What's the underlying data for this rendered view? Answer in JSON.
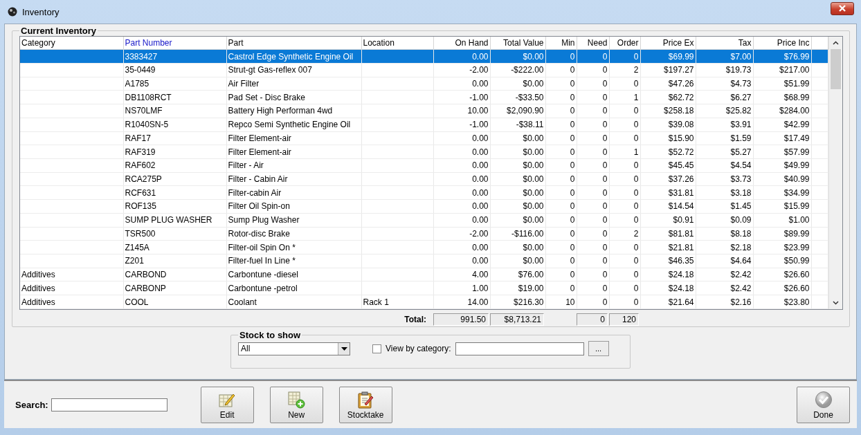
{
  "window": {
    "title": "Inventory"
  },
  "inventory": {
    "title": "Current Inventory",
    "columns": [
      {
        "label": "Category",
        "sorted": false
      },
      {
        "label": "Part Number",
        "sorted": true
      },
      {
        "label": "Part",
        "sorted": false
      },
      {
        "label": "Location",
        "sorted": false
      },
      {
        "label": "On Hand",
        "sorted": false
      },
      {
        "label": "Total Value",
        "sorted": false
      },
      {
        "label": "Min",
        "sorted": false
      },
      {
        "label": "Need",
        "sorted": false
      },
      {
        "label": "Order",
        "sorted": false
      },
      {
        "label": "Price Ex",
        "sorted": false
      },
      {
        "label": "Tax",
        "sorted": false
      },
      {
        "label": "Price Inc",
        "sorted": false
      }
    ],
    "rows": [
      {
        "selected": true,
        "cells": [
          "",
          "3383427",
          "Castrol Edge Synthetic Engine Oil",
          "",
          "0.00",
          "$0.00",
          "0",
          "0",
          "0",
          "$69.99",
          "$7.00",
          "$76.99"
        ]
      },
      {
        "selected": false,
        "cells": [
          "",
          "35-0449",
          "Strut-gt Gas-reflex  007",
          "",
          "-2.00",
          "-$222.00",
          "0",
          "0",
          "2",
          "$197.27",
          "$19.73",
          "$217.00"
        ]
      },
      {
        "selected": false,
        "cells": [
          "",
          "A1785",
          "Air Filter",
          "",
          "0.00",
          "$0.00",
          "0",
          "0",
          "0",
          "$47.26",
          "$4.73",
          "$51.99"
        ]
      },
      {
        "selected": false,
        "cells": [
          "",
          "DB1108RCT",
          "Pad Set - Disc Brake",
          "",
          "-1.00",
          "-$33.50",
          "0",
          "0",
          "1",
          "$62.72",
          "$6.27",
          "$68.99"
        ]
      },
      {
        "selected": false,
        "cells": [
          "",
          "NS70LMF",
          "Battery High Performan 4wd",
          "",
          "10.00",
          "$2,090.90",
          "0",
          "0",
          "0",
          "$258.18",
          "$25.82",
          "$284.00"
        ]
      },
      {
        "selected": false,
        "cells": [
          "",
          "R1040SN-5",
          "Repco Semi Synthetic Engine Oil",
          "",
          "-1.00",
          "-$38.11",
          "0",
          "0",
          "0",
          "$39.08",
          "$3.91",
          "$42.99"
        ]
      },
      {
        "selected": false,
        "cells": [
          "",
          "RAF17",
          "Filter Element-air",
          "",
          "0.00",
          "$0.00",
          "0",
          "0",
          "0",
          "$15.90",
          "$1.59",
          "$17.49"
        ]
      },
      {
        "selected": false,
        "cells": [
          "",
          "RAF319",
          "Filter Element-air",
          "",
          "0.00",
          "$0.00",
          "0",
          "0",
          "1",
          "$52.72",
          "$5.27",
          "$57.99"
        ]
      },
      {
        "selected": false,
        "cells": [
          "",
          "RAF602",
          "Filter - Air",
          "",
          "0.00",
          "$0.00",
          "0",
          "0",
          "0",
          "$45.45",
          "$4.54",
          "$49.99"
        ]
      },
      {
        "selected": false,
        "cells": [
          "",
          "RCA275P",
          "Filter - Cabin Air",
          "",
          "0.00",
          "$0.00",
          "0",
          "0",
          "0",
          "$37.26",
          "$3.73",
          "$40.99"
        ]
      },
      {
        "selected": false,
        "cells": [
          "",
          "RCF631",
          "Filter-cabin Air",
          "",
          "0.00",
          "$0.00",
          "0",
          "0",
          "0",
          "$31.81",
          "$3.18",
          "$34.99"
        ]
      },
      {
        "selected": false,
        "cells": [
          "",
          "ROF135",
          "Filter Oil Spin-on",
          "",
          "0.00",
          "$0.00",
          "0",
          "0",
          "0",
          "$14.54",
          "$1.45",
          "$15.99"
        ]
      },
      {
        "selected": false,
        "cells": [
          "",
          "SUMP PLUG WASHER",
          "Sump Plug Washer",
          "",
          "0.00",
          "$0.00",
          "0",
          "0",
          "0",
          "$0.91",
          "$0.09",
          "$1.00"
        ]
      },
      {
        "selected": false,
        "cells": [
          "",
          "TSR500",
          "Rotor-disc Brake",
          "",
          "-2.00",
          "-$116.00",
          "0",
          "0",
          "2",
          "$81.81",
          "$8.18",
          "$89.99"
        ]
      },
      {
        "selected": false,
        "cells": [
          "",
          "Z145A",
          "Filter-oil Spin On   *",
          "",
          "0.00",
          "$0.00",
          "0",
          "0",
          "0",
          "$21.81",
          "$2.18",
          "$23.99"
        ]
      },
      {
        "selected": false,
        "cells": [
          "",
          "Z201",
          "Filter-fuel In Line   *",
          "",
          "0.00",
          "$0.00",
          "0",
          "0",
          "0",
          "$46.35",
          "$4.64",
          "$50.99"
        ]
      },
      {
        "selected": false,
        "cells": [
          "Additives",
          "CARBOND",
          "Carbontune -diesel",
          "",
          "4.00",
          "$76.00",
          "0",
          "0",
          "0",
          "$24.18",
          "$2.42",
          "$26.60"
        ]
      },
      {
        "selected": false,
        "cells": [
          "Additives",
          "CARBONP",
          "Carbontune -petrol",
          "",
          "1.00",
          "$19.00",
          "0",
          "0",
          "0",
          "$24.18",
          "$2.42",
          "$26.60"
        ]
      },
      {
        "selected": false,
        "cells": [
          "Additives",
          "COOL",
          "Coolant",
          "Rack 1",
          "14.00",
          "$216.30",
          "10",
          "0",
          "0",
          "$21.64",
          "$2.16",
          "$23.80"
        ]
      }
    ],
    "totals": {
      "label": "Total:",
      "on_hand": "991.50",
      "total_value": "$8,713.21",
      "need": "0",
      "order": "120"
    }
  },
  "stock_to_show": {
    "title": "Stock to show",
    "dropdown": {
      "value": "All"
    },
    "view_by_category": {
      "label": "View by category:",
      "checked": false
    },
    "browse_button": "..."
  },
  "search": {
    "label": "Search:"
  },
  "buttons": [
    {
      "kind": "edit",
      "label": "Edit"
    },
    {
      "kind": "new",
      "label": "New"
    },
    {
      "kind": "stocktake",
      "label": "Stocktake"
    }
  ],
  "done_button": {
    "label": "Done"
  }
}
